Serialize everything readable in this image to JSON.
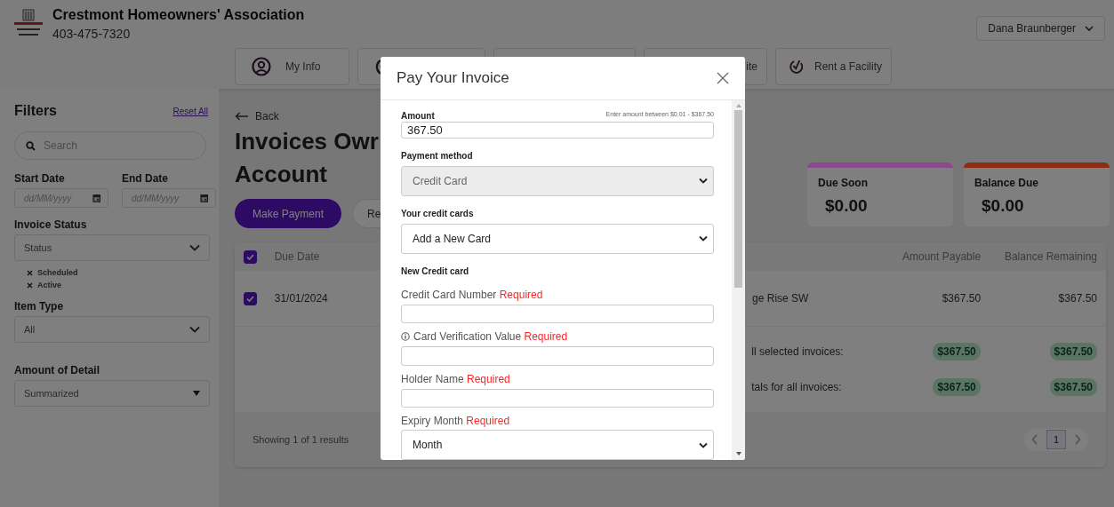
{
  "header": {
    "org_name": "Crestmont Homeowners' Association",
    "phone": "403-475-7320",
    "user_menu": "Dana Braunberger"
  },
  "nav": [
    {
      "label": "My Info",
      "icon": true
    },
    {
      "icon": true
    },
    {
      "icon": false
    },
    {
      "label": "ite",
      "icon": false
    },
    {
      "label": "Rent a Facility",
      "icon": true
    }
  ],
  "filters": {
    "title": "Filters",
    "reset": "Reset All",
    "search_placeholder": "Search",
    "start_date": {
      "label": "Start Date",
      "placeholder": "dd/MM/yyyy"
    },
    "end_date": {
      "label": "End Date",
      "placeholder": "dd/MM/yyyy"
    },
    "invoice_status": {
      "label": "Invoice Status",
      "value": "Status",
      "chips": [
        "Scheduled",
        "Active"
      ]
    },
    "item_type": {
      "label": "Item Type",
      "value": "All"
    },
    "detail": {
      "label": "Amount of Detail",
      "value": "Summarized"
    }
  },
  "main": {
    "back": "Back",
    "title_lines": [
      "Invoices Owr",
      "Account"
    ],
    "make_payment": "Make Payment",
    "second_button": "Re",
    "cards": [
      {
        "title": "Due Soon",
        "amount": "$0.00",
        "color": "#8c4a8e"
      },
      {
        "title": "Balance Due",
        "amount": "$0.00",
        "color": "#8e2c14"
      }
    ],
    "table": {
      "select_all": true,
      "columns": [
        "Due Date",
        "Amount Payable",
        "Balance Remaining"
      ],
      "rows": [
        {
          "selected": true,
          "due_date": "31/01/2024",
          "description": "ge Rise SW",
          "amount": "$367.50",
          "balance": "$367.50"
        }
      ],
      "totals": [
        {
          "label": "ll selected invoices:",
          "amount": "$367.50",
          "balance": "$367.50"
        },
        {
          "label": "tals for all invoices:",
          "amount": "$367.50",
          "balance": "$367.50"
        }
      ],
      "footer": "Showing 1 of 1 results",
      "pages": [
        {
          "label": "1",
          "selected": true
        }
      ]
    }
  },
  "modal": {
    "title": "Pay Your Invoice",
    "amount": {
      "label": "Amount",
      "hint": "Enter amount between $0.01 - $367.50",
      "value": "367.50"
    },
    "payment_method": {
      "label": "Payment method",
      "value": "Credit Card",
      "disabled": true
    },
    "credit_cards": {
      "label": "Your credit cards",
      "value": "Add a New Card",
      "disabled": false
    },
    "section": "New Credit card",
    "fields": [
      {
        "kind": "input",
        "label": "Credit Card Number",
        "required": "Required",
        "info": false
      },
      {
        "kind": "input",
        "label": "Card Verification Value",
        "required": "Required",
        "info": true
      },
      {
        "kind": "input",
        "label": "Holder Name",
        "required": "Required",
        "info": false
      },
      {
        "kind": "select",
        "label": "Expiry Month",
        "required": "Required",
        "info": false,
        "value": "Month"
      }
    ]
  }
}
